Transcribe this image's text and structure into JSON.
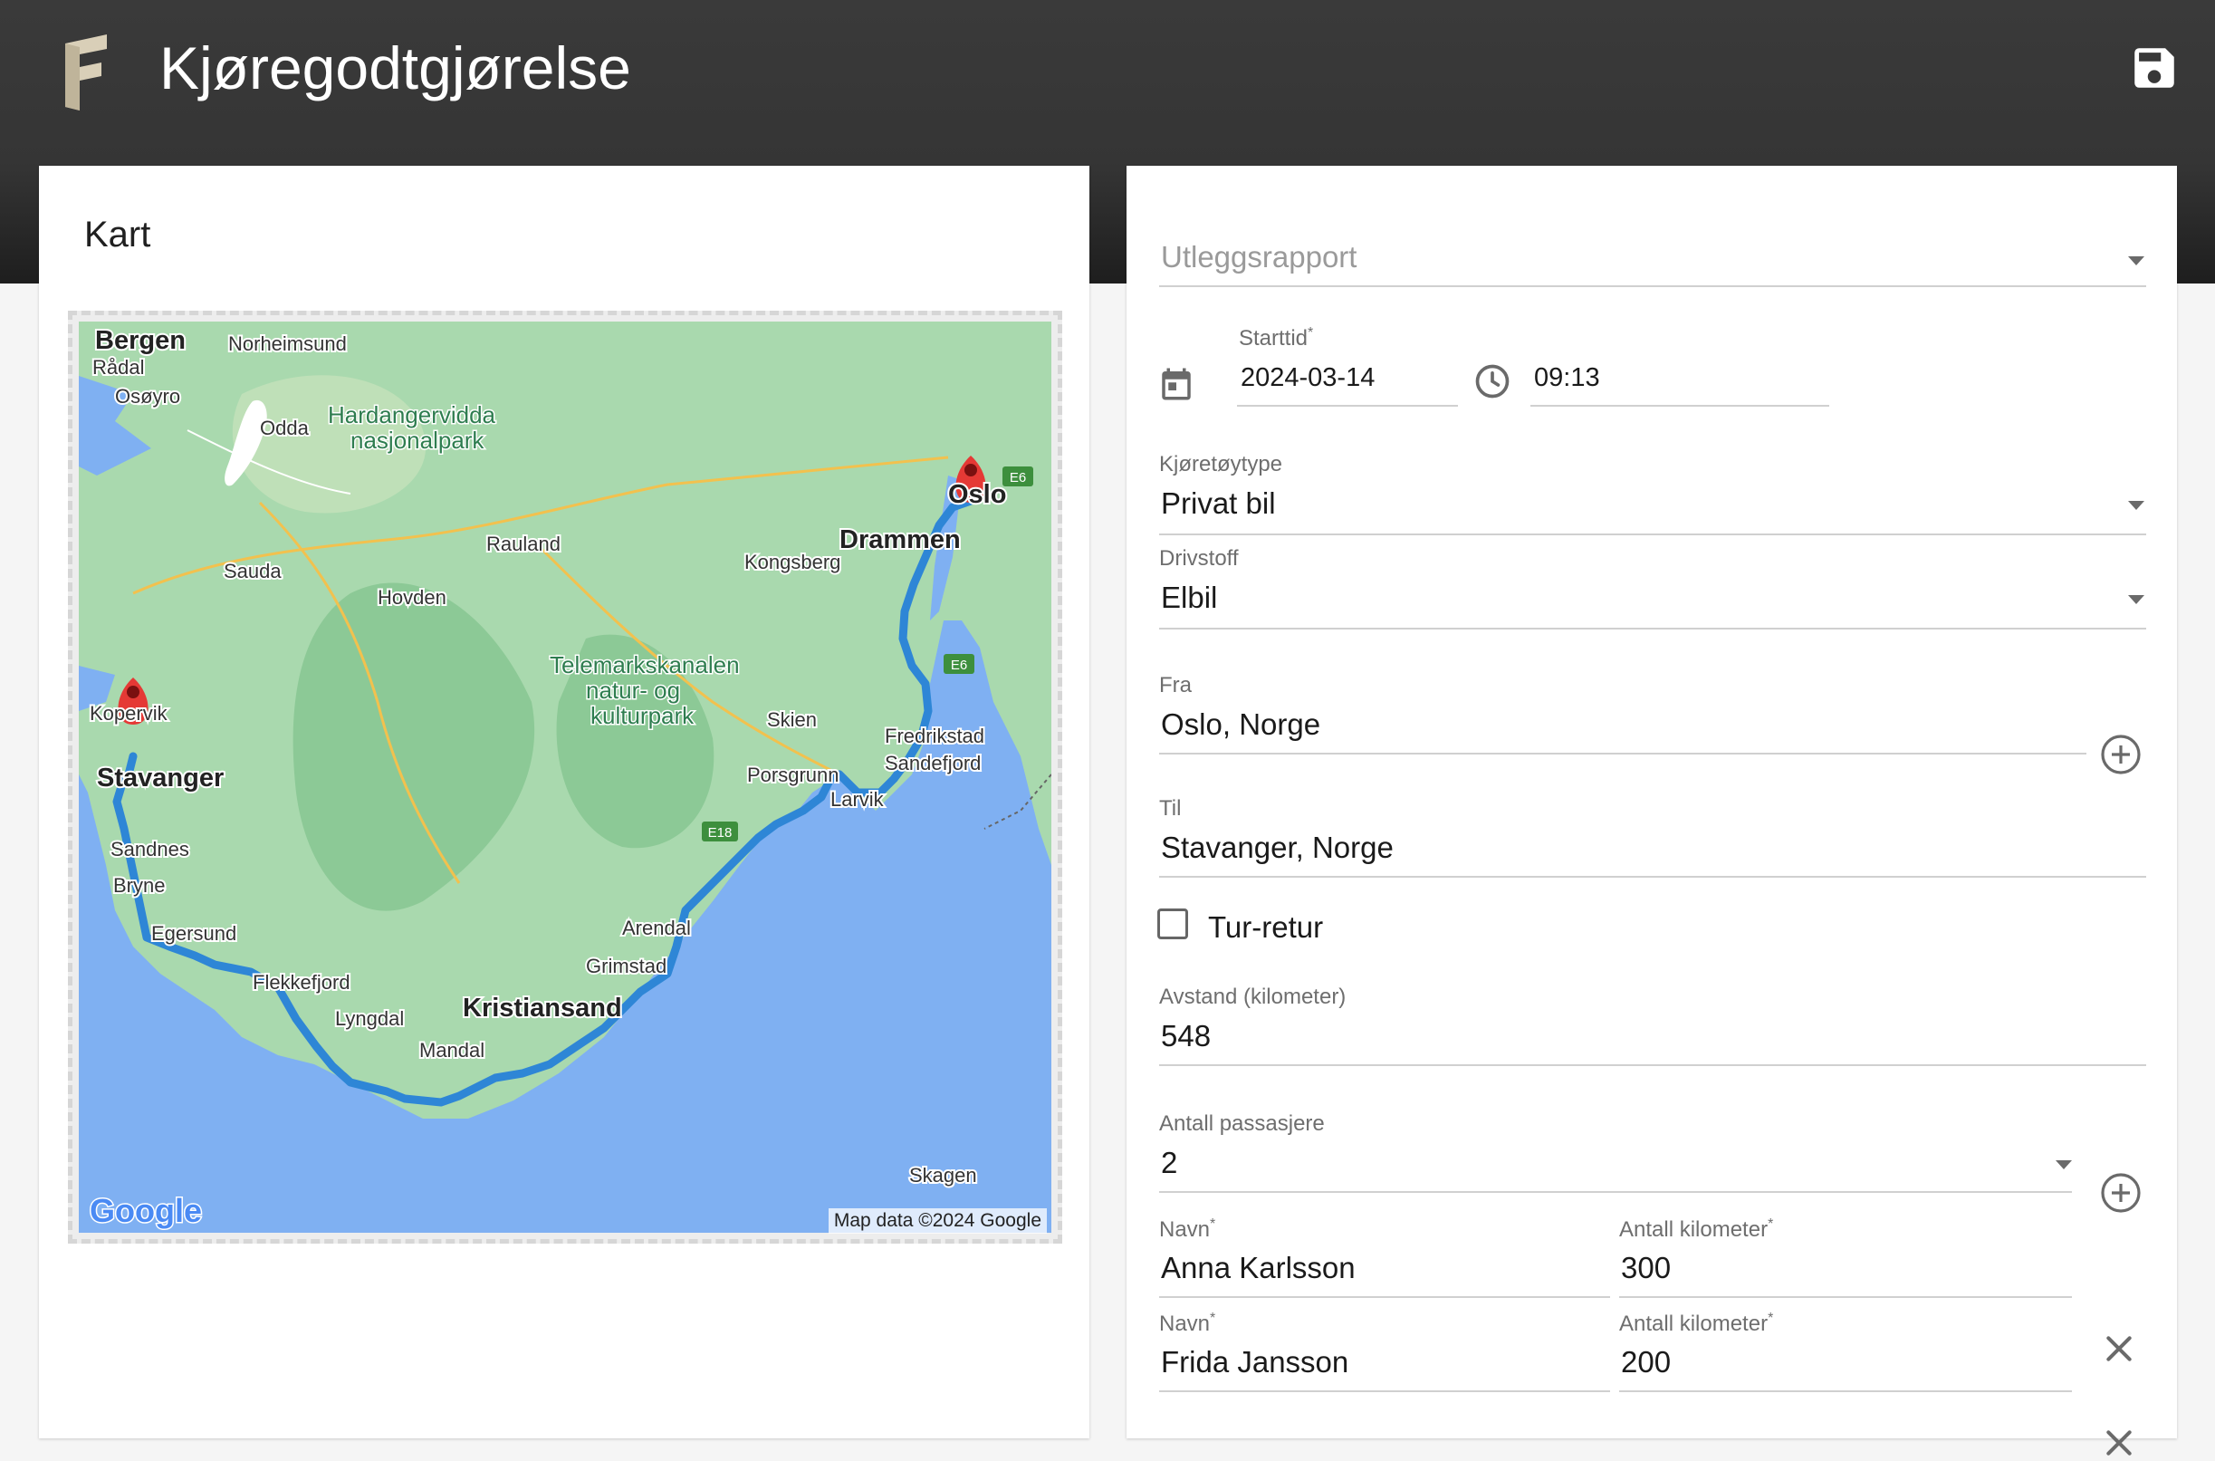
{
  "app": {
    "title": "Kjøregodtgjørelse",
    "brand_color": "#d9cfb8",
    "appbar_color": "#353535"
  },
  "map_card": {
    "title": "Kart",
    "attribution": "Map data ©2024 Google",
    "google_logo": "Google",
    "route_color": "#2e86d6",
    "water_color": "#7fb0f2",
    "land_color": "#9fd3a5",
    "places": {
      "bergen": "Bergen",
      "norheimsund": "Norheimsund",
      "radal": "Rådal",
      "osoyro": "Osøyro",
      "odda": "Odda",
      "hardangervidda": "Hardangervidda",
      "nasjonalpark": "nasjonalpark",
      "rauland": "Rauland",
      "sauda": "Sauda",
      "hovden": "Hovden",
      "kongsberg": "Kongsberg",
      "drammen": "Drammen",
      "oslo": "Oslo",
      "telemark1": "Telemarkskanalen",
      "telemark2": "natur- og",
      "telemark3": "kulturpark",
      "kopervik": "Kopervik",
      "skien": "Skien",
      "fredrikstad": "Fredrikstad",
      "sandefjord": "Sandefjord",
      "porsgrunn": "Porsgrunn",
      "larvik": "Larvik",
      "stavanger": "Stavanger",
      "sandnes": "Sandnes",
      "bryne": "Bryne",
      "egersund": "Egersund",
      "arendal": "Arendal",
      "grimstad": "Grimstad",
      "flekkefjord": "Flekkefjord",
      "lyngdal": "Lyngdal",
      "kristiansand": "Kristiansand",
      "mandal": "Mandal",
      "skagen": "Skagen",
      "e6": "E6",
      "e18": "E18"
    }
  },
  "form": {
    "expense_report": {
      "placeholder": "Utleggsrapport",
      "value": ""
    },
    "start": {
      "label": "Starttid",
      "required_mark": "*",
      "date": "2024-03-14",
      "time": "09:13"
    },
    "vehicle_type": {
      "label": "Kjøretøytype",
      "value": "Privat bil"
    },
    "fuel": {
      "label": "Drivstoff",
      "value": "Elbil"
    },
    "from": {
      "label": "Fra",
      "value": "Oslo, Norge"
    },
    "to": {
      "label": "Til",
      "value": "Stavanger, Norge"
    },
    "round_trip": {
      "label": "Tur-retur",
      "checked": false
    },
    "distance": {
      "label": "Avstand (kilometer)",
      "value": "548"
    },
    "passenger_count": {
      "label": "Antall passasjere",
      "value": "2"
    },
    "passengers": [
      {
        "name_label": "Navn",
        "name": "Anna Karlsson",
        "km_label": "Antall kilometer",
        "km": "300",
        "required_mark": "*"
      },
      {
        "name_label": "Navn",
        "name": "Frida Jansson",
        "km_label": "Antall kilometer",
        "km": "200",
        "required_mark": "*"
      }
    ]
  }
}
